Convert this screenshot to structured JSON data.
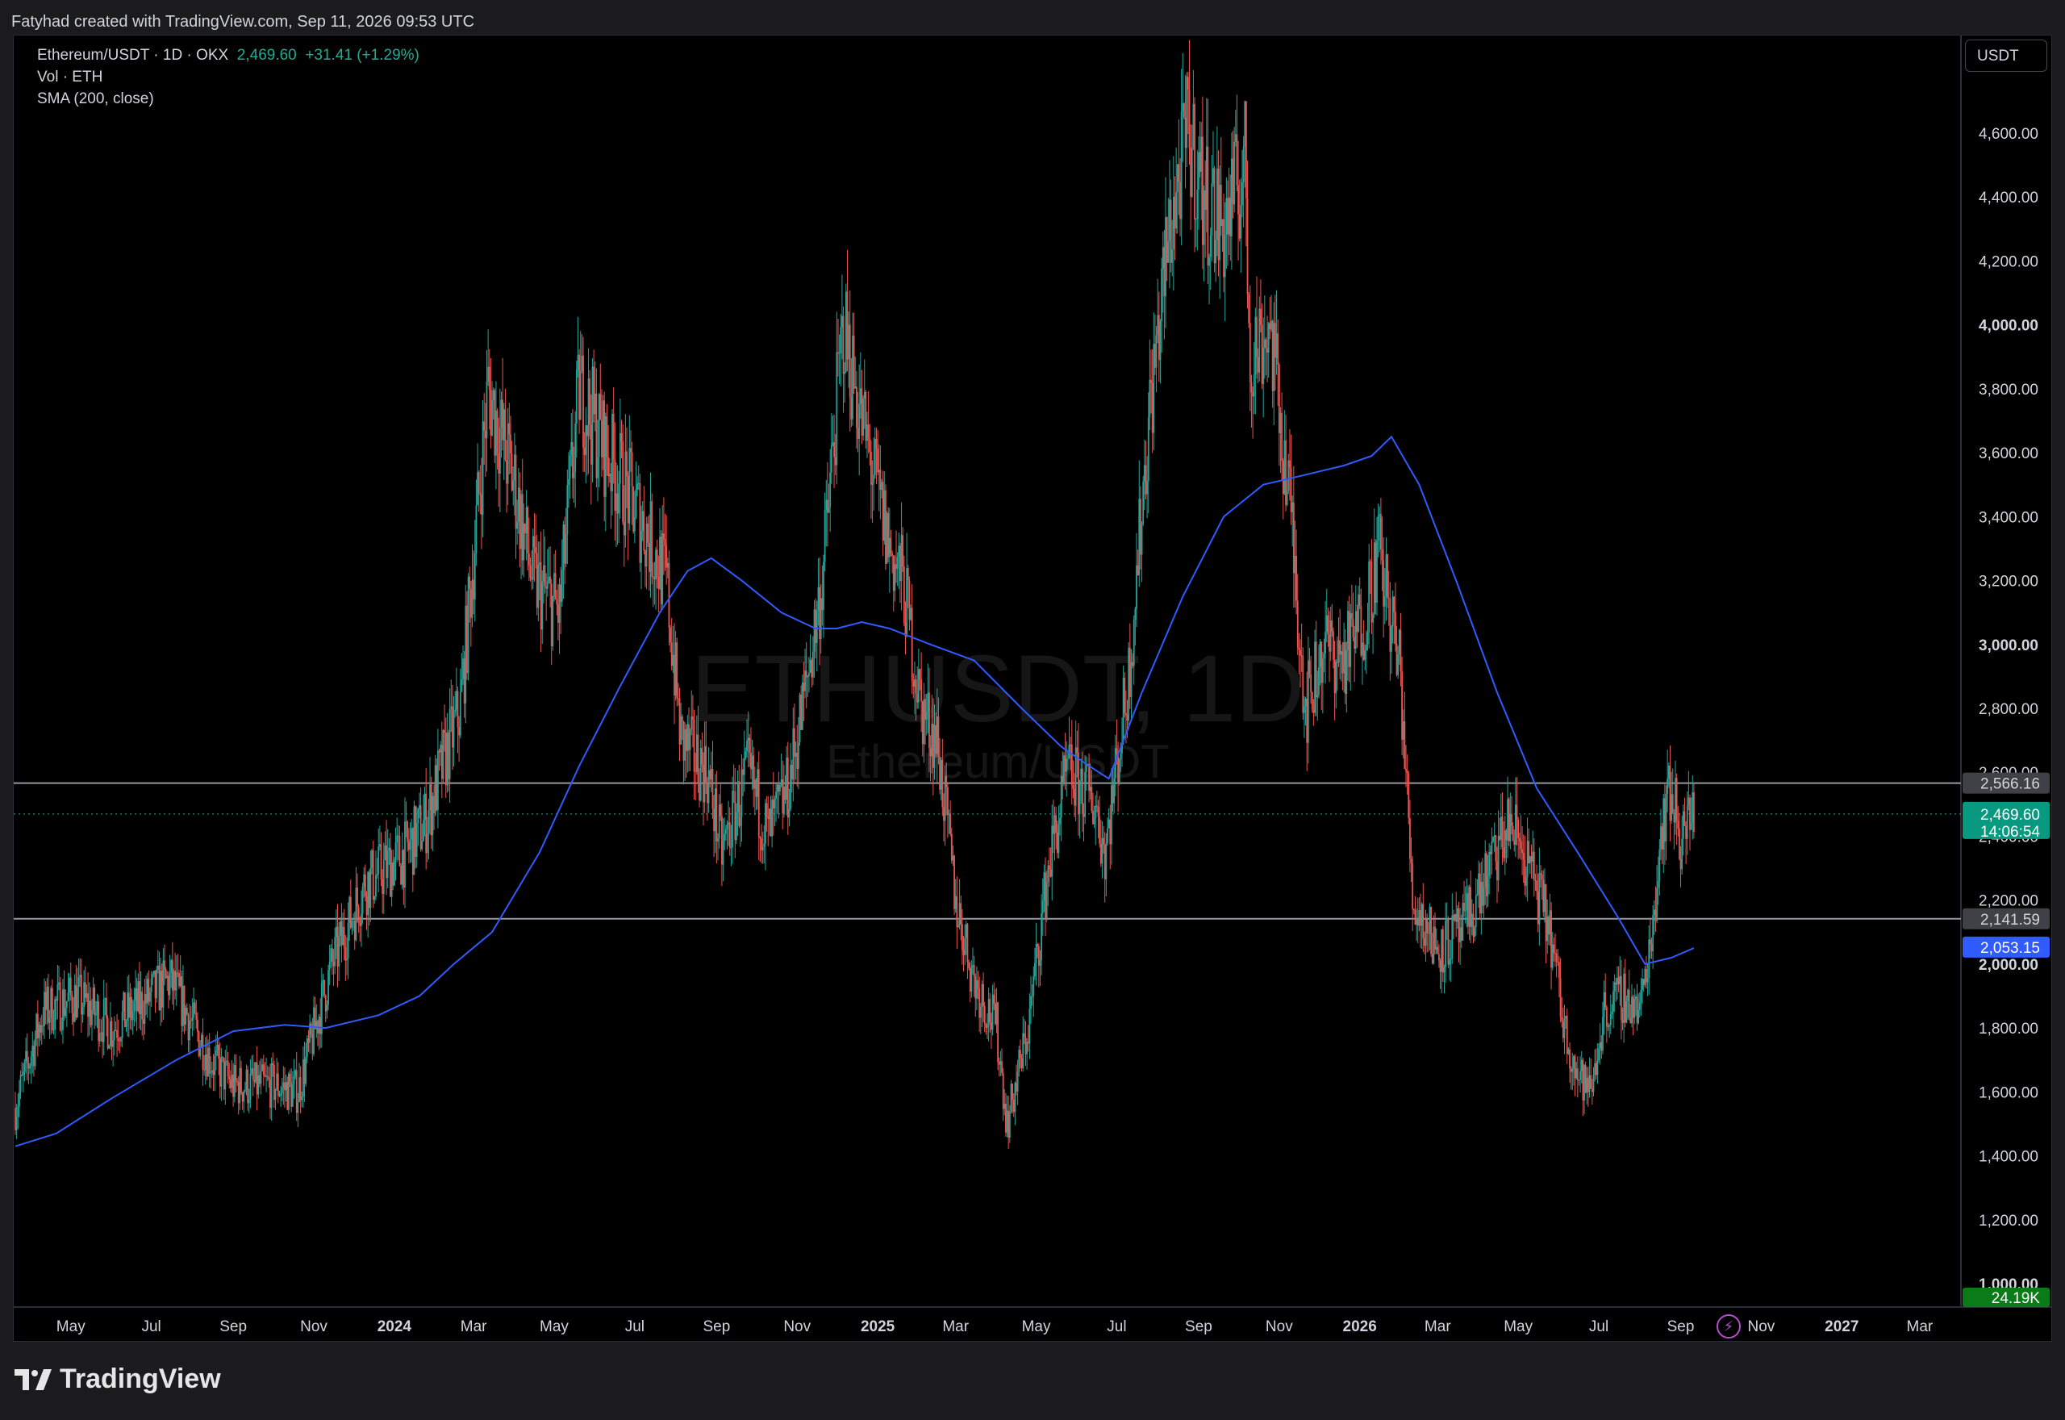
{
  "header": {
    "attribution": "Fatyhad created with TradingView.com, Sep 11, 2026 09:53 UTC"
  },
  "legend": {
    "symbol": "Ethereum/USDT · 1D · OKX",
    "price": "2,469.60",
    "change": "+31.41 (+1.29%)",
    "volume": "Vol · ETH",
    "sma": "SMA (200, close)"
  },
  "currency_button": "USDT",
  "watermark": {
    "main": "ETHUSDT, 1D",
    "sub": "Ethereum/USDT"
  },
  "brand": "TradingView",
  "colors": {
    "up": "#26a69a",
    "down": "#ef5350",
    "sma": "#2f5bff",
    "last_price": "#089981",
    "volume_badge": "#0b7a18"
  },
  "chart_data": {
    "type": "line",
    "ylim": [
      1000,
      4800
    ],
    "y_ticks": [
      "1,000.00",
      "1,200.00",
      "1,400.00",
      "1,600.00",
      "1,800.00",
      "2,000.00",
      "2,200.00",
      "2,400.00",
      "2,600.00",
      "2,800.00",
      "3,000.00",
      "3,200.00",
      "3,400.00",
      "3,600.00",
      "3,800.00",
      "4,000.00",
      "4,200.00",
      "4,400.00",
      "4,600.00"
    ],
    "y_ticks_bold": [
      "1,000.00",
      "2,000.00",
      "3,000.00",
      "4,000.00"
    ],
    "x_ticks": [
      "May",
      "Jul",
      "Sep",
      "Nov",
      "2024",
      "Mar",
      "May",
      "Jul",
      "Sep",
      "Nov",
      "2025",
      "Mar",
      "May",
      "Jul",
      "Sep",
      "Nov",
      "2026",
      "Mar",
      "May",
      "Jul",
      "Sep",
      "Nov",
      "2027",
      "Mar"
    ],
    "x_ticks_bold": [
      "2024",
      "2025",
      "2026",
      "2027"
    ],
    "price_series": {
      "name": "Ethereum/USDT",
      "x": [
        "2023-03-20",
        "2023-04-10",
        "2023-05-05",
        "2023-06-01",
        "2023-07-01",
        "2023-07-15",
        "2023-08-15",
        "2023-09-01",
        "2023-10-01",
        "2023-10-20",
        "2023-11-15",
        "2023-12-10",
        "2024-01-10",
        "2024-01-25",
        "2024-02-20",
        "2024-03-12",
        "2024-04-01",
        "2024-04-15",
        "2024-05-05",
        "2024-05-20",
        "2024-06-10",
        "2024-07-05",
        "2024-07-25",
        "2024-08-05",
        "2024-08-25",
        "2024-09-05",
        "2024-09-25",
        "2024-10-10",
        "2024-10-25",
        "2024-11-05",
        "2024-11-20",
        "2024-12-06",
        "2024-12-20",
        "2025-01-10",
        "2025-01-20",
        "2025-02-03",
        "2025-02-15",
        "2025-03-01",
        "2025-03-15",
        "2025-04-01",
        "2025-04-09",
        "2025-04-25",
        "2025-05-10",
        "2025-05-25",
        "2025-06-15",
        "2025-06-22",
        "2025-07-10",
        "2025-07-25",
        "2025-08-10",
        "2025-08-24",
        "2025-09-05",
        "2025-09-20",
        "2025-10-06",
        "2025-10-10",
        "2025-10-25",
        "2025-11-10",
        "2025-11-21",
        "2025-12-05",
        "2025-12-20",
        "2026-01-05",
        "2026-01-15",
        "2026-02-01",
        "2026-02-10",
        "2026-03-01",
        "2026-03-20",
        "2026-04-10",
        "2026-04-25",
        "2026-05-10",
        "2026-05-25",
        "2026-06-05",
        "2026-06-15",
        "2026-06-25",
        "2026-07-05",
        "2026-07-20",
        "2026-08-01",
        "2026-08-10",
        "2026-08-18",
        "2026-08-25",
        "2026-09-01",
        "2026-09-11"
      ],
      "values": [
        1550,
        1850,
        1900,
        1800,
        1900,
        1950,
        1700,
        1620,
        1620,
        1600,
        2000,
        2250,
        2350,
        2450,
        2800,
        3800,
        3500,
        3200,
        3100,
        3800,
        3600,
        3400,
        3200,
        2700,
        2600,
        2350,
        2600,
        2400,
        2550,
        2800,
        3200,
        4000,
        3700,
        3300,
        3200,
        2800,
        2700,
        2200,
        1950,
        1800,
        1500,
        1800,
        2300,
        2600,
        2500,
        2350,
        2900,
        3700,
        4300,
        4600,
        4400,
        4300,
        4500,
        3900,
        4000,
        3400,
        2800,
        3000,
        2950,
        3100,
        3300,
        2900,
        2200,
        2050,
        2100,
        2300,
        2450,
        2300,
        2100,
        1800,
        1650,
        1600,
        1850,
        1900,
        1850,
        2100,
        2450,
        2550,
        2400,
        2469.6
      ]
    },
    "sma_series": {
      "name": "SMA (200, close)",
      "x": [
        "2023-03-20",
        "2023-04-20",
        "2023-06-01",
        "2023-07-20",
        "2023-09-01",
        "2023-10-10",
        "2023-11-10",
        "2023-12-20",
        "2024-01-20",
        "2024-02-15",
        "2024-03-15",
        "2024-04-20",
        "2024-05-20",
        "2024-06-20",
        "2024-07-20",
        "2024-08-10",
        "2024-08-28",
        "2024-09-20",
        "2024-10-20",
        "2024-11-15",
        "2024-12-01",
        "2024-12-20",
        "2025-01-10",
        "2025-02-10",
        "2025-03-15",
        "2025-04-20",
        "2025-05-20",
        "2025-06-10",
        "2025-06-25",
        "2025-07-20",
        "2025-08-20",
        "2025-09-20",
        "2025-10-20",
        "2025-11-20",
        "2025-12-20",
        "2026-01-10",
        "2026-01-25",
        "2026-02-15",
        "2026-03-15",
        "2026-04-15",
        "2026-05-15",
        "2026-06-15",
        "2026-07-15",
        "2026-08-05",
        "2026-08-25",
        "2026-09-11"
      ],
      "values": [
        1430,
        1470,
        1580,
        1700,
        1790,
        1810,
        1800,
        1840,
        1900,
        2000,
        2100,
        2350,
        2620,
        2870,
        3100,
        3230,
        3270,
        3200,
        3100,
        3050,
        3050,
        3070,
        3050,
        3000,
        2950,
        2800,
        2680,
        2620,
        2580,
        2850,
        3150,
        3400,
        3500,
        3530,
        3560,
        3590,
        3650,
        3500,
        3200,
        2850,
        2550,
        2350,
        2150,
        2000,
        2020,
        2050
      ]
    },
    "horizontal_lines": [
      2566.16,
      2141.59
    ],
    "price_labels": [
      {
        "text": "2,566.16",
        "value": 2566.16,
        "kind": "line"
      },
      {
        "text": "2,469.60",
        "value": 2469.6,
        "kind": "last"
      },
      {
        "text": "14:06:54",
        "value": 2469.6,
        "kind": "countdown"
      },
      {
        "text": "2,141.59",
        "value": 2141.59,
        "kind": "line"
      },
      {
        "text": "2,053.15",
        "value": 2053.15,
        "kind": "sma"
      },
      {
        "text": "24.19K",
        "value": 1000,
        "kind": "volume"
      }
    ]
  }
}
